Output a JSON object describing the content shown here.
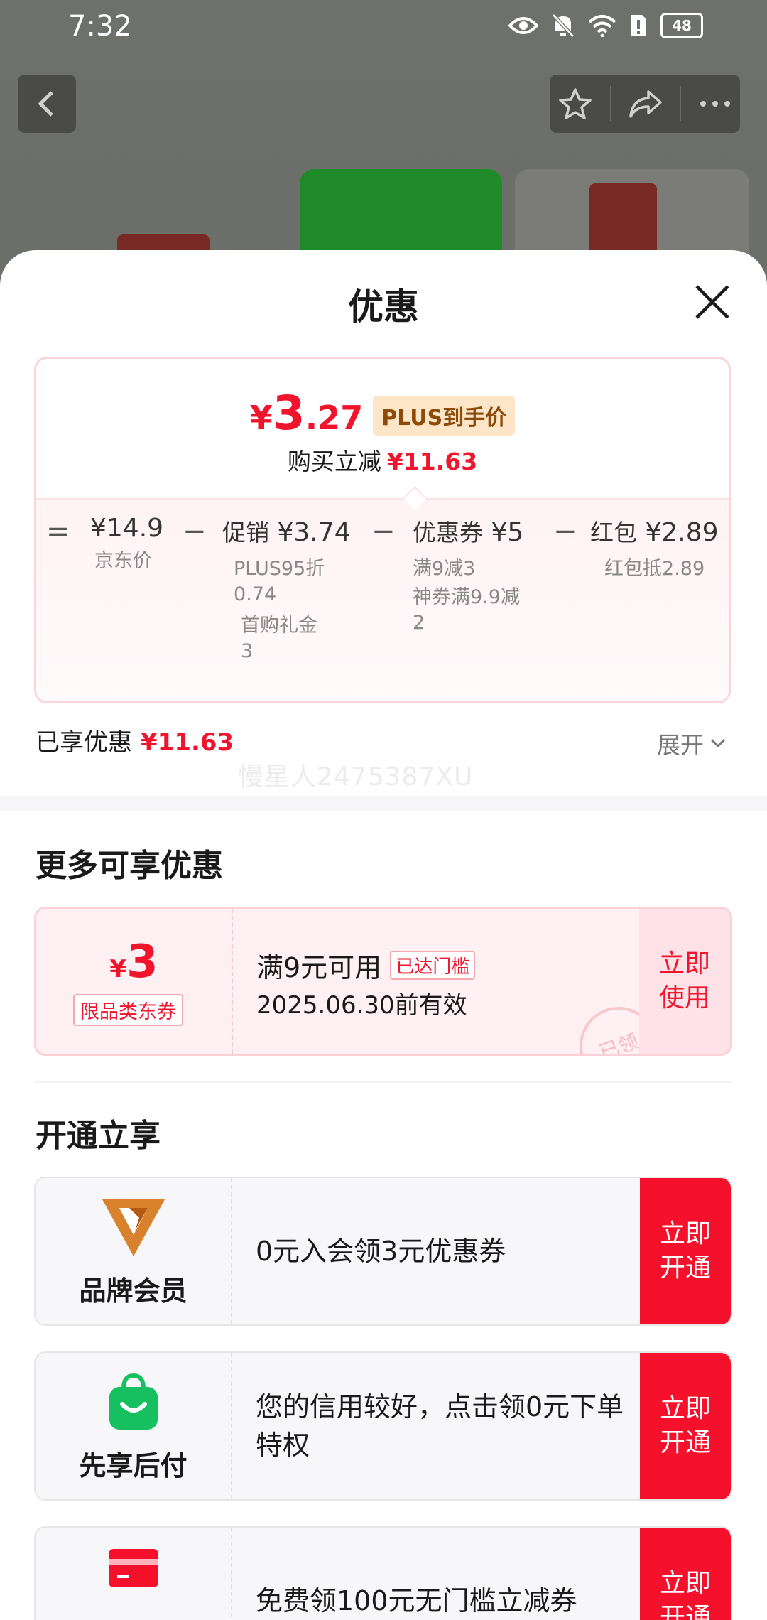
{
  "status": {
    "time": "7:32",
    "battery": "48"
  },
  "sheet": {
    "title": "优惠",
    "price": {
      "currency": "¥",
      "integer": "3",
      "decimal": ".27",
      "tag": "PLUS到手价",
      "reduce_label": "购买立减",
      "reduce_value": "¥11.63"
    },
    "breakdown": {
      "eq": "=",
      "minus": "−",
      "items": [
        {
          "label": "",
          "value": "¥14.9",
          "subs": [
            "京东价"
          ]
        },
        {
          "label": "促销",
          "value": "¥3.74",
          "subs": [
            "PLUS95折",
            "0.74",
            "首购礼金",
            "3"
          ]
        },
        {
          "label": "优惠券",
          "value": "¥5",
          "subs": [
            "满9减3",
            "神券满9.9减",
            "2"
          ]
        },
        {
          "label": "红包",
          "value": "¥2.89",
          "subs": [
            "红包抵2.89"
          ]
        }
      ]
    },
    "saved_label": "已享优惠",
    "saved_value": "¥11.63",
    "expand_label": "展开",
    "watermark": "慢星人2475387XU"
  },
  "more": {
    "title": "更多可享优惠",
    "coupon": {
      "currency": "¥",
      "amount": "3",
      "type": "限品类东券",
      "condition": "满9元可用",
      "reached": "已达门槛",
      "expiry": "2025.06.30前有效",
      "button": "立即使用",
      "stamp": "已领"
    }
  },
  "open": {
    "title": "开通立享",
    "cards": [
      {
        "name": "品牌会员",
        "icon": "brand-member-v-icon",
        "text": "0元入会领3元优惠券",
        "button": "立即开通"
      },
      {
        "name": "先享后付",
        "icon": "shopping-bag-smile-icon",
        "text": "您的信用较好，点击领0元下单特权",
        "button": "立即开通"
      },
      {
        "name": "",
        "icon": "credit-card-icon",
        "text": "免费领100元无门槛立减券",
        "button": "立即开通"
      }
    ]
  },
  "colors": {
    "accent_red": "#f0142d",
    "plus_tag_bg": "#fde5c8",
    "coupon_bg": "#fff1f3"
  }
}
